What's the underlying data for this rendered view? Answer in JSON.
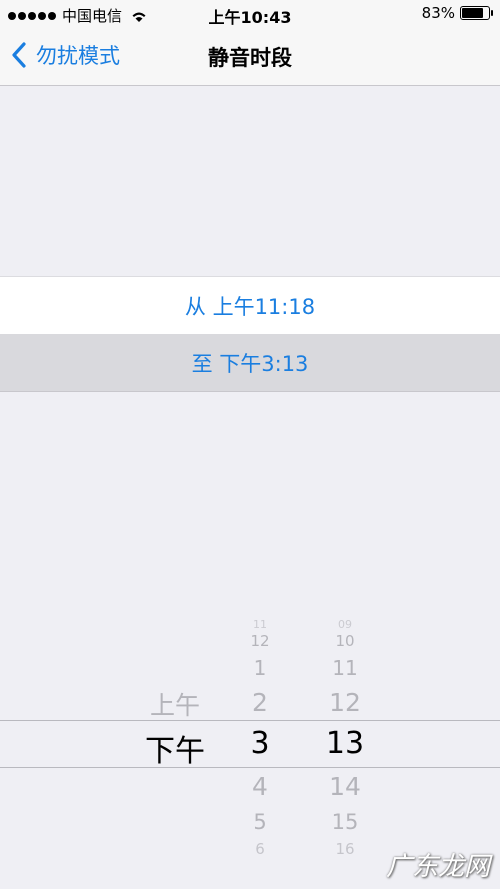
{
  "status": {
    "carrier": "中国电信",
    "time": "上午10:43",
    "battery": "83%",
    "battery_level": 0.83
  },
  "nav": {
    "back_label": "勿扰模式",
    "title": "静音时段"
  },
  "schedule": {
    "from": "从 上午11:18",
    "to": "至 下午3:13"
  },
  "picker": {
    "ampm": [
      "上午",
      "下午"
    ],
    "hours": [
      "11",
      "12",
      "1",
      "2",
      "3",
      "4",
      "5",
      "6"
    ],
    "minutes": [
      "09",
      "10",
      "11",
      "12",
      "13",
      "14",
      "15",
      "16"
    ],
    "selected": {
      "ampm": "下午",
      "hour": "3",
      "minute": "13"
    }
  },
  "watermark": "广东龙网"
}
